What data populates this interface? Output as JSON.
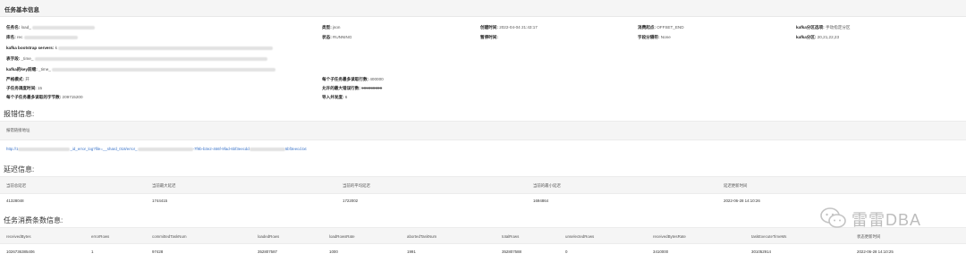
{
  "panel": {
    "title": "任务基本信息"
  },
  "basic": {
    "task_name_label": "任务名:",
    "task_name_value": "load_",
    "db_label": "库名:",
    "db_value": "rec",
    "type_label": "类型:",
    "type_value": "json",
    "create_time_label": "创建时间:",
    "create_time_value": "2022-04-04 21:43:17",
    "start_label": "消费起点:",
    "start_value": "OFFSET_END",
    "kafka_partition_select_label": "kafka分区选项:",
    "kafka_partition_select_value": "手动指定分区",
    "state_label": "状态:",
    "state_value": "RUNNING",
    "pause_time_label": "暂停时间:",
    "separator_label": "字段分隔符:",
    "separator_value": "None",
    "kafka_partition_label": "kafka分区:",
    "kafka_partition_value": "20,21,22,23",
    "bootstrap_label": "kafka bootstrap servers:",
    "bootstrap_value": "k",
    "table_label": "表字段:",
    "table_value": "_time_",
    "key_label": "kafka的key前缀:",
    "key_value": "_time_",
    "strict_label": "严格模式:",
    "strict_value": "开",
    "max_rows_label": "每个子任务最多读取行数:",
    "max_rows_value": "400000",
    "concurrency_label": "子任务调度时间:",
    "concurrency_value": "15",
    "max_error_label": "允许的最大错误行数:",
    "max_error_value": "999999999",
    "max_bytes_label": "每个子任务最多读取的字节数:",
    "max_bytes_value": "209715200",
    "import_parallel_label": "导入并发度:",
    "import_parallel_value": "6"
  },
  "error_section": {
    "title": "报错信息:",
    "header": "报错链接地址",
    "link_prefix": "http://1",
    "link_mid": "_id_error_log?file=__shard_018/error_",
    "link_mid2": "-7f9b-b3e2-466f-9fad-6bf3eecdd",
    "link_suffix": "6bf3eecd.txt"
  },
  "delay_section": {
    "title": "延迟信息:",
    "headers": [
      "当前总延迟",
      "当前最大延迟",
      "当前的平均延迟",
      "当前的最小延迟",
      "延迟更新时间"
    ],
    "values": [
      "41328048",
      "1744415",
      "1722002",
      "1694864",
      "2022-06-28 14:10:26"
    ]
  },
  "stats_section": {
    "title": "任务消费条数信息:",
    "headers": [
      "receivedBytes",
      "errorRows",
      "committedTaskNum",
      "loadedRows",
      "loadRowsRate",
      "abortedTaskNum",
      "totalRows",
      "unselectedRows",
      "receivedBytesRate",
      "taskExecuteTimeMs",
      "状态更新时间"
    ],
    "values": [
      "1026736385406",
      "1",
      "97428",
      "352807587",
      "1000",
      "1991",
      "352807588",
      "0",
      "3410000",
      "301052914",
      "2022-06-28 14:10:25"
    ]
  },
  "watermark": {
    "text": "雷雷DBA"
  }
}
